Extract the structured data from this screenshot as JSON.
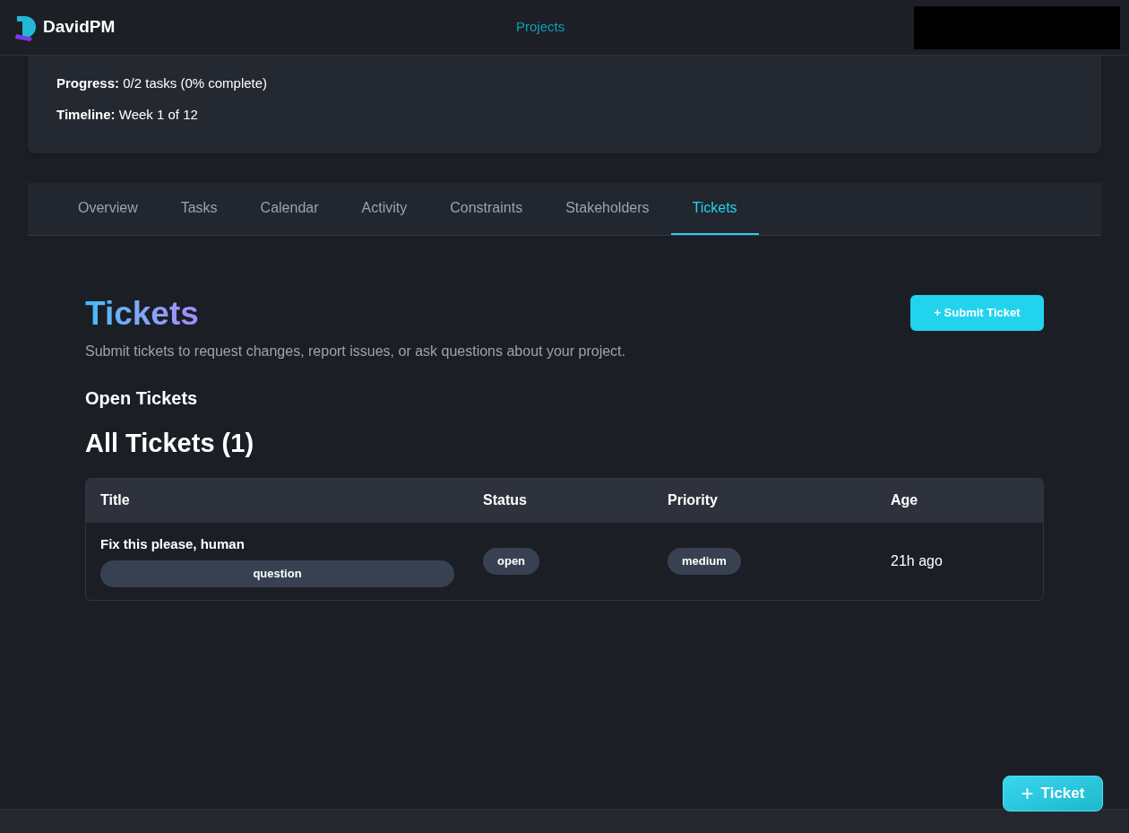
{
  "header": {
    "brand": "DavidPM",
    "nav": [
      {
        "label": "Projects",
        "selected": true
      }
    ]
  },
  "project": {
    "progress_label": "Progress:",
    "progress": "0/2 tasks (0% complete)",
    "timeline_label": "Timeline:",
    "timeline": "Week 1 of 12"
  },
  "tabs": [
    {
      "label": "Overview",
      "selected": false
    },
    {
      "label": "Tasks",
      "selected": false
    },
    {
      "label": "Calendar",
      "selected": false
    },
    {
      "label": "Activity",
      "selected": false
    },
    {
      "label": "Constraints",
      "selected": false
    },
    {
      "label": "Stakeholders",
      "selected": false
    },
    {
      "label": "Tickets",
      "selected": true
    }
  ],
  "tickets": {
    "title": "Tickets",
    "subtitle": "Submit tickets to request changes, report issues, or ask questions about your project.",
    "submit_button": "+ Submit Ticket",
    "open_heading": "Open Tickets",
    "all_heading": "All Tickets (1)",
    "table": {
      "columns": [
        "Title",
        "Status",
        "Priority",
        "Age"
      ],
      "rows": [
        {
          "title": "Fix this please, human",
          "type": "question",
          "status": "open",
          "priority": "medium",
          "age": "21h ago"
        }
      ]
    }
  },
  "fab": {
    "icon": "+",
    "label": "Ticket"
  }
}
